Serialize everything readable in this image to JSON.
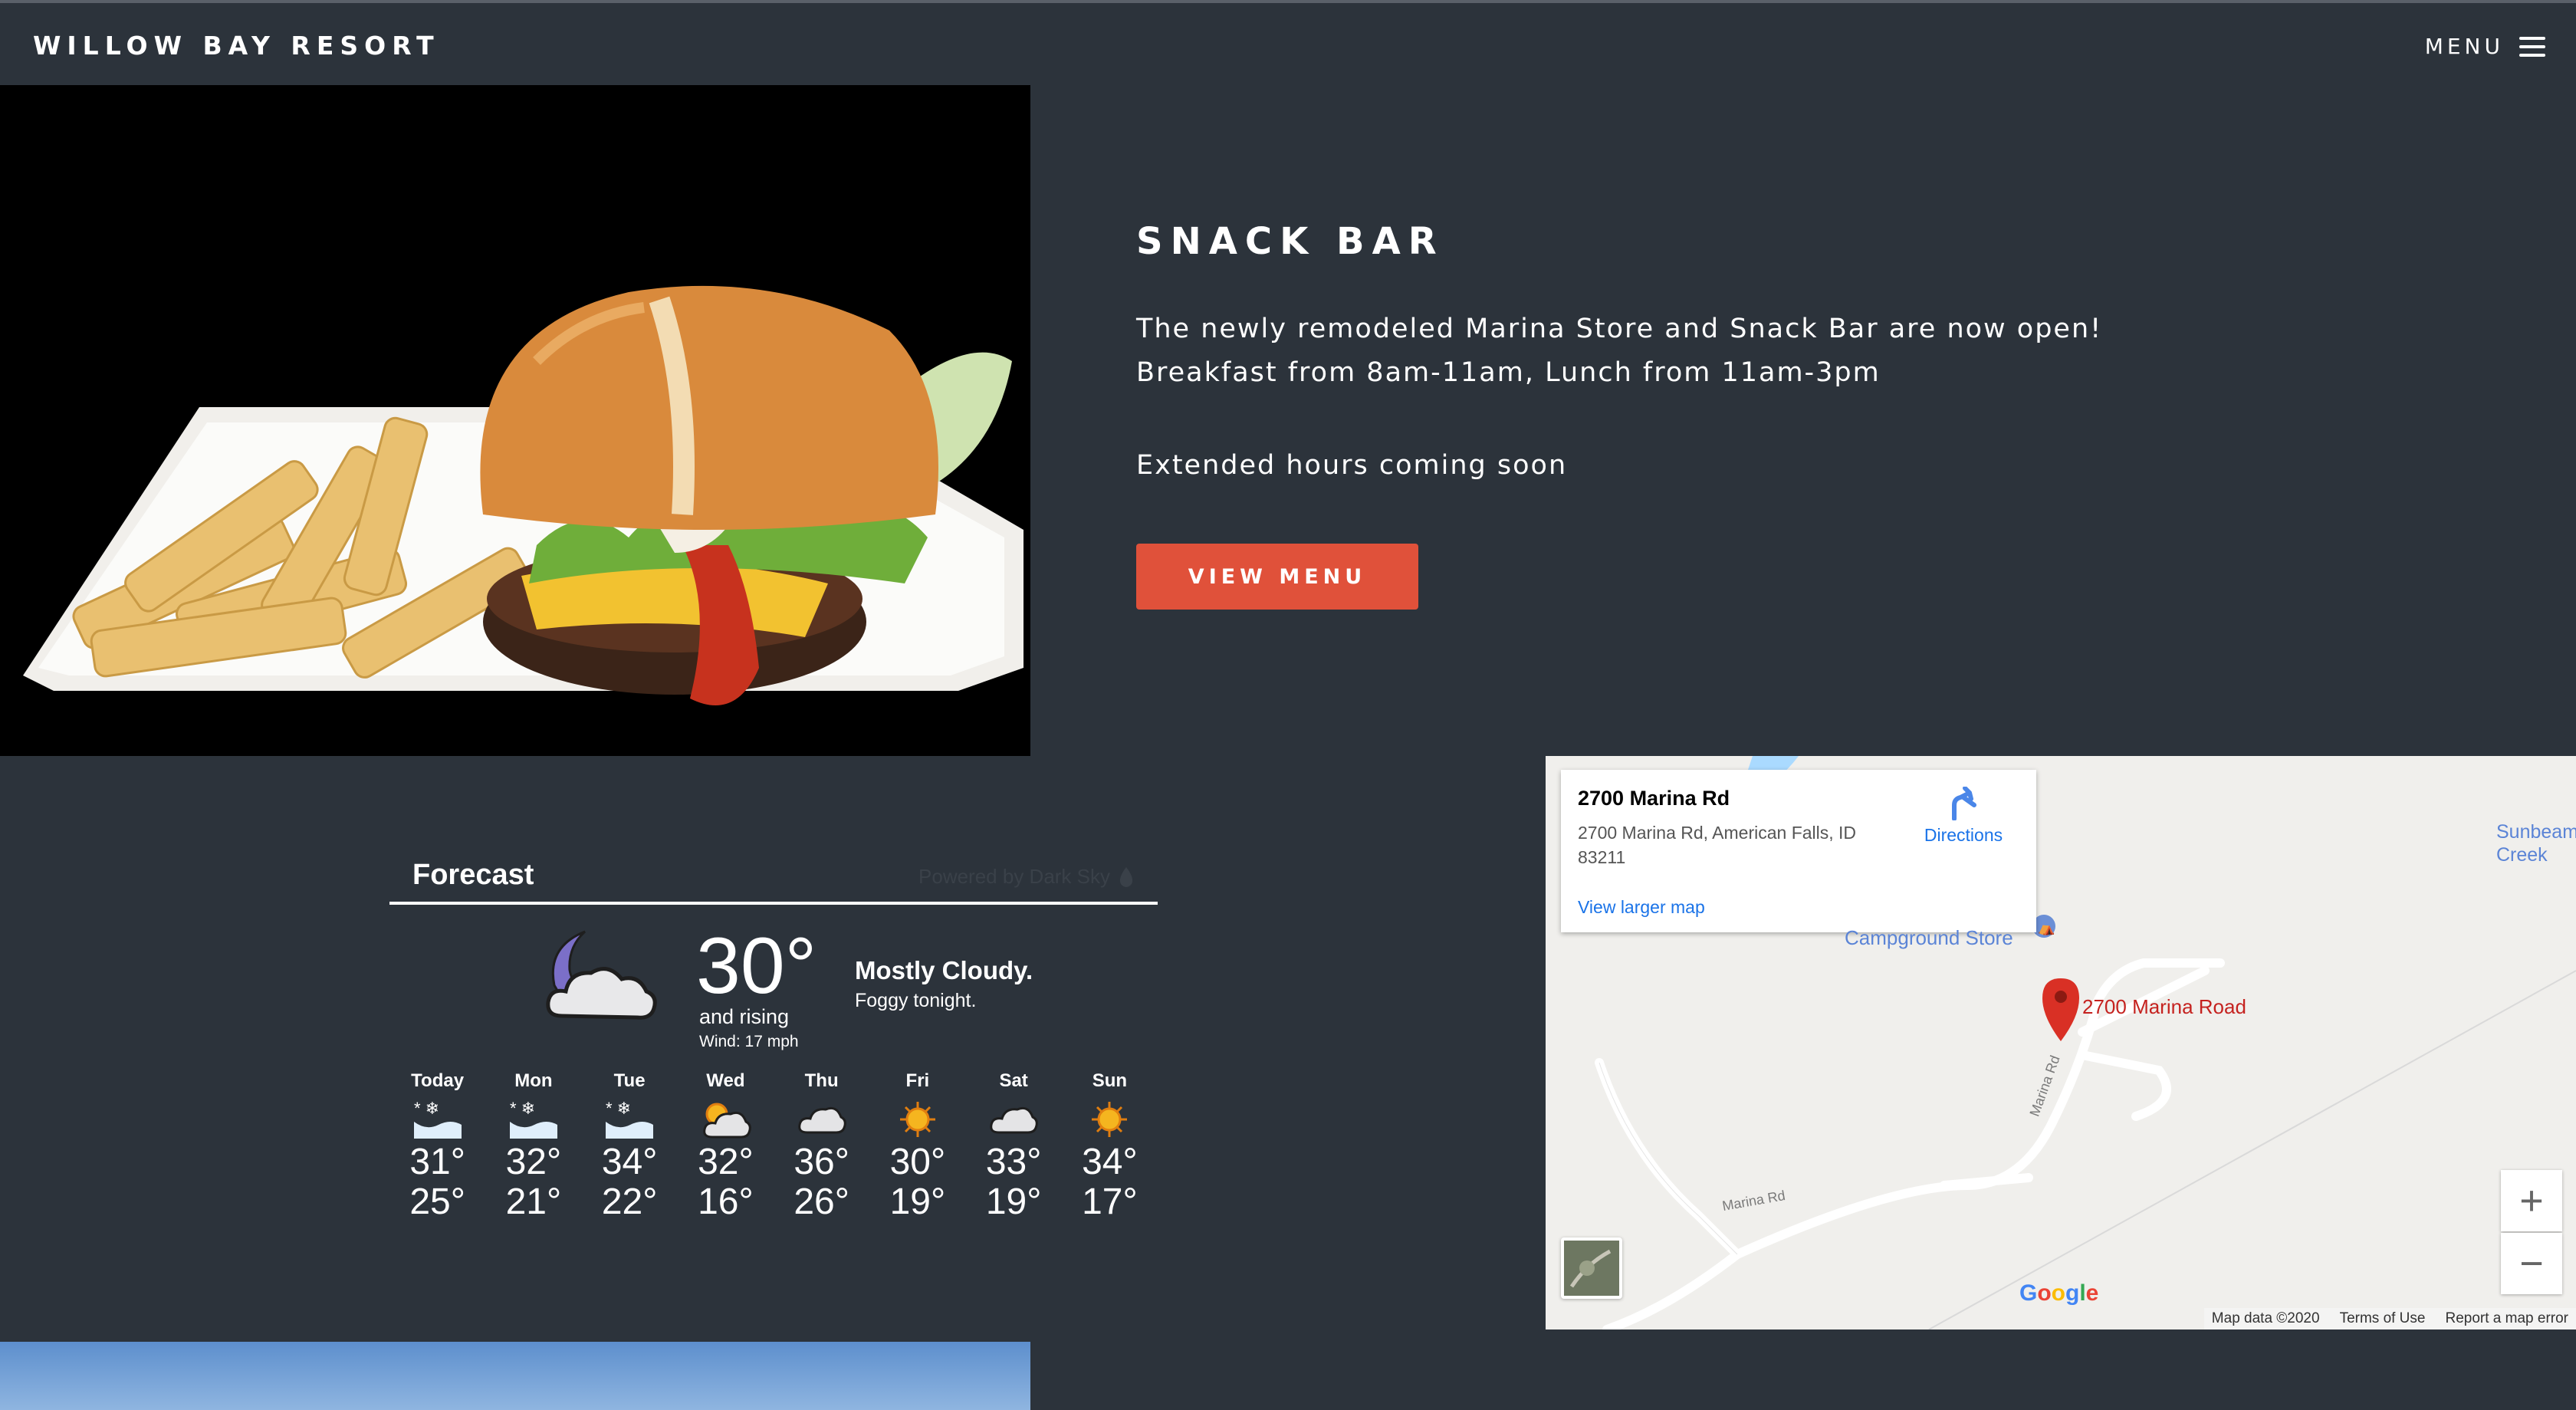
{
  "header": {
    "brand": "WILLOW BAY RESORT",
    "menu_label": "MENU"
  },
  "hero": {
    "image_alt": "burger-and-fries-photo",
    "title": "SNACK BAR",
    "description_line1": "The newly remodeled Marina Store and Snack Bar are now open!",
    "description_line2": "Breakfast from 8am-11am, Lunch from 11am-3pm",
    "extra": "Extended hours coming soon",
    "button_label": "VIEW MENU",
    "accent_color": "#e0513a"
  },
  "forecast": {
    "title": "Forecast",
    "credit": "Powered by Dark Sky",
    "current": {
      "temp": "30°",
      "trend": "and rising",
      "wind": "Wind: 17 mph",
      "summary": "Mostly Cloudy.",
      "detail": "Foggy tonight.",
      "icon": "partly-cloudy-night-icon"
    },
    "days": [
      {
        "name": "Today",
        "icon": "snow-icon",
        "hi": "31°",
        "lo": "25°"
      },
      {
        "name": "Mon",
        "icon": "snow-icon",
        "hi": "32°",
        "lo": "21°"
      },
      {
        "name": "Tue",
        "icon": "snow-icon",
        "hi": "34°",
        "lo": "22°"
      },
      {
        "name": "Wed",
        "icon": "partly-cloudy-day-icon",
        "hi": "32°",
        "lo": "16°"
      },
      {
        "name": "Thu",
        "icon": "cloudy-icon",
        "hi": "36°",
        "lo": "26°"
      },
      {
        "name": "Fri",
        "icon": "sunny-icon",
        "hi": "30°",
        "lo": "19°"
      },
      {
        "name": "Sat",
        "icon": "cloudy-icon",
        "hi": "33°",
        "lo": "19°"
      },
      {
        "name": "Sun",
        "icon": "sunny-icon",
        "hi": "34°",
        "lo": "17°"
      }
    ]
  },
  "map": {
    "card_title": "2700 Marina Rd",
    "card_address": "2700 Marina Rd, American Falls, ID 83211",
    "directions_label": "Directions",
    "larger_map_label": "View larger map",
    "campground_label": "Campground Store",
    "pin_label": "2700 Marina Road",
    "road_label_1": "Marina Rd",
    "road_label_2": "Marina Rd",
    "corner_label": "Sunbeam Creek",
    "zoom_in": "+",
    "zoom_out": "−",
    "footer": {
      "data": "Map data ©2020",
      "terms": "Terms of Use",
      "report": "Report a map error"
    },
    "google_logo": "Google"
  }
}
